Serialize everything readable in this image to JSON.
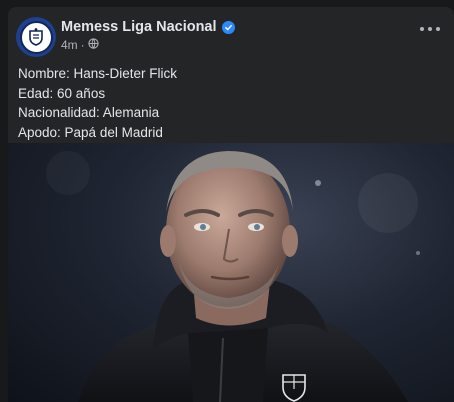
{
  "post": {
    "page_name": "Memess Liga Nacional",
    "time": "4m",
    "separator": "·",
    "lines": [
      "Nombre: Hans-Dieter Flick",
      "Edad: 60 años",
      "Nacionalidad: Alemania",
      "Apodo: Papá del Madrid"
    ]
  },
  "colors": {
    "card": "#242526",
    "text": "#e4e6eb",
    "secondary_text": "#b0b3b8",
    "verified_badge": "#2d88ff"
  },
  "icons": {
    "avatar": "club-crest-icon",
    "verified": "verified-badge-icon",
    "audience": "globe-icon",
    "more": "more-options-icon"
  }
}
